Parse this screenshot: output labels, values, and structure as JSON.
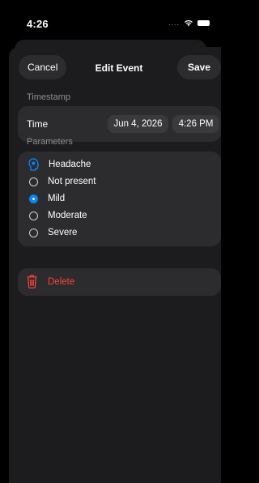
{
  "status_bar": {
    "time": "4:26",
    "signal_dots": "....",
    "wifi_icon": "wifi-icon",
    "battery_icon": "battery-icon"
  },
  "nav": {
    "cancel_label": "Cancel",
    "title": "Edit Event",
    "save_label": "Save"
  },
  "timestamp": {
    "header": "Timestamp",
    "row_label": "Time",
    "date_value": "Jun 4, 2026",
    "time_value": "4:26 PM"
  },
  "parameters": {
    "header": "Parameters",
    "symptom_icon": "head-icon",
    "symptom_label": "Headache",
    "options": [
      {
        "label": "Not present",
        "selected": false
      },
      {
        "label": "Mild",
        "selected": true
      },
      {
        "label": "Moderate",
        "selected": false
      },
      {
        "label": "Severe",
        "selected": false
      }
    ]
  },
  "delete": {
    "icon": "trash-icon",
    "label": "Delete"
  },
  "colors": {
    "background": "#000000",
    "sheet": "#1c1c1e",
    "group": "#2c2c2e",
    "accent": "#0a84ff",
    "destructive": "#ff453a",
    "secondary_text": "#8e8e93"
  }
}
